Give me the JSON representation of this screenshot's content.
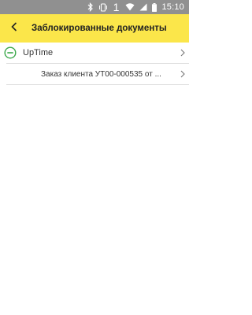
{
  "status_bar": {
    "sim_label": "1",
    "time": "15:10",
    "icons": [
      "bluetooth-icon",
      "vibrate-icon",
      "wifi-icon",
      "signal-icon",
      "battery-icon"
    ]
  },
  "header": {
    "title": "Заблокированные документы",
    "background_color": "#fbe64a"
  },
  "tree": {
    "group": {
      "label": "UpTime",
      "state": "expanded",
      "items": [
        {
          "label": "Заказ клиента УТ00-000535 от ..."
        }
      ]
    }
  },
  "colors": {
    "accent_green": "#3aa84a",
    "status_bar": "#909090"
  }
}
